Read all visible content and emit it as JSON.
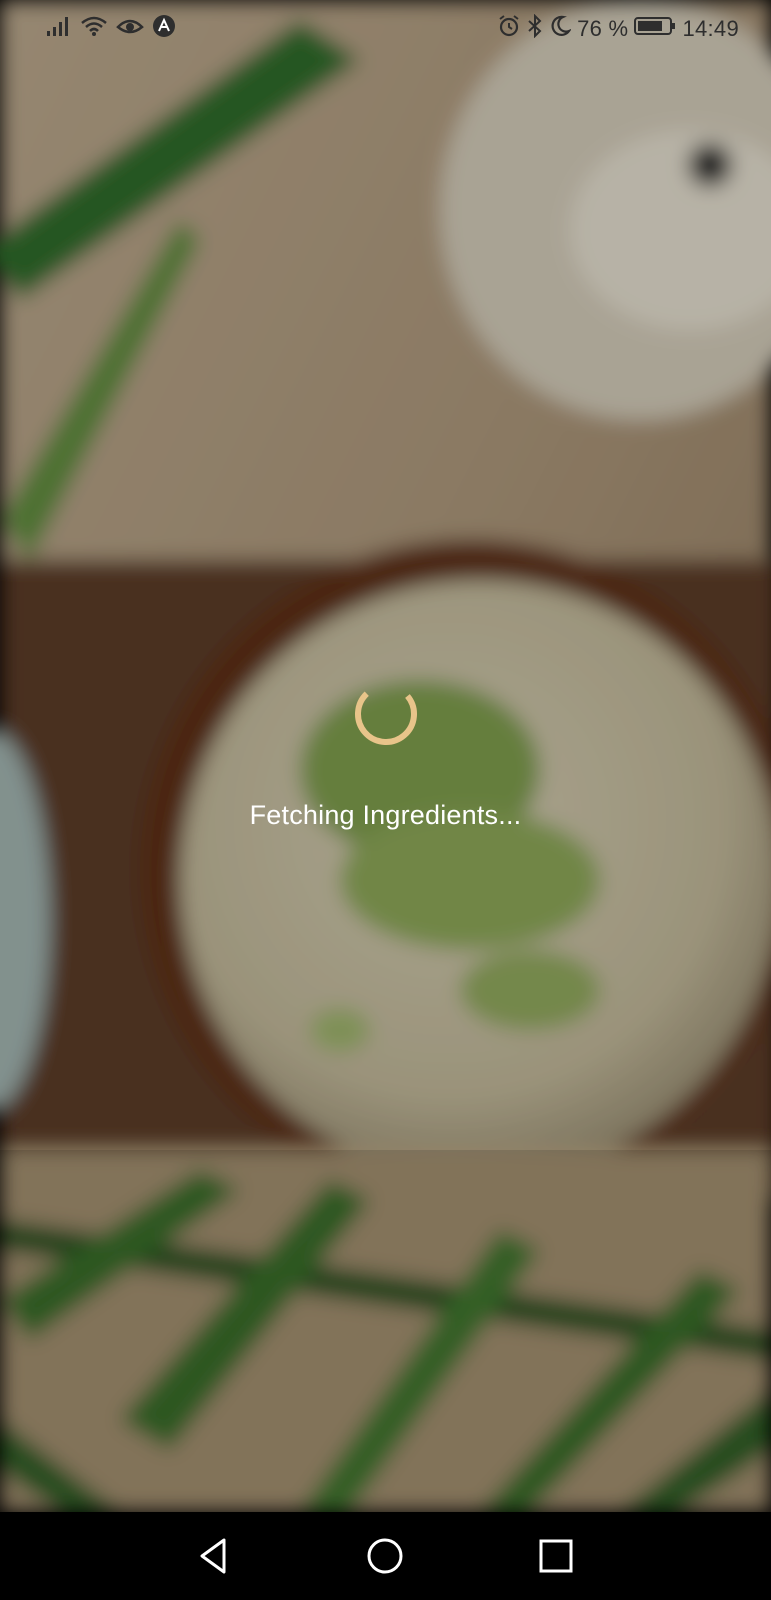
{
  "status_bar": {
    "battery_percent": "76 %",
    "time": "14:49",
    "left_icons": [
      "signal-icon",
      "wifi-icon",
      "eye-comfort-icon",
      "app-notification-icon"
    ],
    "right_icons": [
      "alarm-icon",
      "bluetooth-icon",
      "moon-icon",
      "battery-icon"
    ]
  },
  "loader": {
    "message": "Fetching Ingredients...",
    "spinner_color": "#e8c48a"
  },
  "nav_bar": {
    "buttons": [
      "back-button",
      "home-button",
      "recents-button"
    ]
  },
  "colors": {
    "text": "#ffffff",
    "nav_background": "#000000",
    "status_text": "#2e2e2e"
  }
}
